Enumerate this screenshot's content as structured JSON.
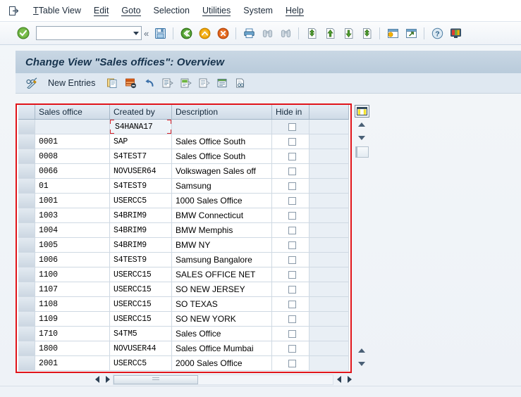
{
  "menubar": {
    "system_icon": "exit-arrow-icon",
    "items": [
      {
        "label": "Table View",
        "accel": "T"
      },
      {
        "label": "Edit",
        "accel": "E"
      },
      {
        "label": "Goto",
        "accel": "G"
      },
      {
        "label": "Selection",
        "accel": "l"
      },
      {
        "label": "Utilities",
        "accel": "i"
      },
      {
        "label": "System",
        "accel": "y"
      },
      {
        "label": "Help",
        "accel": "H"
      }
    ]
  },
  "toolbar": {
    "enter_label": "enter-check-icon",
    "command_field": {
      "value": "",
      "placeholder": ""
    },
    "more_label": "«",
    "buttons": [
      {
        "name": "save-button",
        "icon": "save-disk-icon"
      },
      {
        "name": "back-button",
        "icon": "back-green-arrow-icon"
      },
      {
        "name": "exit-button",
        "icon": "exit-yellow-arrow-icon"
      },
      {
        "name": "cancel-button",
        "icon": "cancel-red-x-icon"
      },
      {
        "name": "print-button",
        "icon": "printer-icon"
      },
      {
        "name": "find-button",
        "icon": "binoculars-icon"
      },
      {
        "name": "find-next-button",
        "icon": "binoculars-plus-icon"
      },
      {
        "name": "first-page-button",
        "icon": "first-page-icon"
      },
      {
        "name": "previous-page-button",
        "icon": "previous-page-icon"
      },
      {
        "name": "next-page-button",
        "icon": "next-page-icon"
      },
      {
        "name": "last-page-button",
        "icon": "last-page-icon"
      },
      {
        "name": "create-session-button",
        "icon": "new-session-icon"
      },
      {
        "name": "create-shortcut-button",
        "icon": "shortcut-arrow-icon"
      },
      {
        "name": "help-button",
        "icon": "question-mark-icon"
      },
      {
        "name": "customize-local-layout-button",
        "icon": "layout-monitor-icon"
      }
    ]
  },
  "panel": {
    "title": "Change View \"Sales offices\": Overview",
    "subtoolbar": {
      "display_change_icon": "glasses-pencil-icon",
      "new_entries_label": "New Entries",
      "buttons": [
        {
          "name": "copy-as-button",
          "icon": "copy-document-icon"
        },
        {
          "name": "delete-button",
          "icon": "delete-row-icon"
        },
        {
          "name": "undo-button",
          "icon": "undo-arrow-icon"
        },
        {
          "name": "previous-entry-button",
          "icon": "page-up-entry-icon"
        },
        {
          "name": "next-entry-button",
          "icon": "page-down-entry-icon"
        },
        {
          "name": "select-entry-button",
          "icon": "page-entry-icon"
        },
        {
          "name": "details-button",
          "icon": "details-list-icon"
        },
        {
          "name": "variant-button",
          "icon": "magnify-document-icon"
        }
      ]
    }
  },
  "grid": {
    "columns": [
      {
        "key": "select",
        "label": ""
      },
      {
        "key": "sales_office",
        "label": "Sales office"
      },
      {
        "key": "created_by",
        "label": "Created by"
      },
      {
        "key": "description",
        "label": "Description"
      },
      {
        "key": "hide_in",
        "label": "Hide in"
      }
    ],
    "focused_cell": {
      "row": 0,
      "column": "created_by",
      "value": "S4HANA17"
    },
    "rows": [
      {
        "sales_office": "",
        "created_by": "S4HANA17",
        "description": "",
        "hide_in": false,
        "focused": true
      },
      {
        "sales_office": "0001",
        "created_by": "SAP",
        "description": "Sales Office South",
        "hide_in": false
      },
      {
        "sales_office": "0008",
        "created_by": "S4TEST7",
        "description": "Sales Office South",
        "hide_in": false
      },
      {
        "sales_office": "0066",
        "created_by": "NOVUSER64",
        "description": "Volkswagen Sales off",
        "hide_in": false
      },
      {
        "sales_office": "01",
        "created_by": "S4TEST9",
        "description": "Samsung",
        "hide_in": false
      },
      {
        "sales_office": "1001",
        "created_by": "USERCC5",
        "description": "1000 Sales Office",
        "hide_in": false
      },
      {
        "sales_office": "1003",
        "created_by": "S4BRIM9",
        "description": "BMW Connecticut",
        "hide_in": false
      },
      {
        "sales_office": "1004",
        "created_by": "S4BRIM9",
        "description": "BMW Memphis",
        "hide_in": false
      },
      {
        "sales_office": "1005",
        "created_by": "S4BRIM9",
        "description": "BMW NY",
        "hide_in": false
      },
      {
        "sales_office": "1006",
        "created_by": "S4TEST9",
        "description": "Samsung Bangalore",
        "hide_in": false
      },
      {
        "sales_office": "1100",
        "created_by": "USERCC15",
        "description": "SALES OFFICE NET",
        "hide_in": false
      },
      {
        "sales_office": "1107",
        "created_by": "USERCC15",
        "description": "SO NEW JERSEY",
        "hide_in": false
      },
      {
        "sales_office": "1108",
        "created_by": "USERCC15",
        "description": "SO TEXAS",
        "hide_in": false
      },
      {
        "sales_office": "1109",
        "created_by": "USERCC15",
        "description": "SO NEW YORK",
        "hide_in": false
      },
      {
        "sales_office": "1710",
        "created_by": "S4TM5",
        "description": "Sales Office",
        "hide_in": false
      },
      {
        "sales_office": "1800",
        "created_by": "NOVUSER44",
        "description": "Sales Office Mumbai",
        "hide_in": false
      },
      {
        "sales_office": "2001",
        "created_by": "USERCC5",
        "description": "2000 Sales Office",
        "hide_in": false
      }
    ]
  },
  "controls": {
    "config_icon": "column-configuration-icon",
    "scroll_up_icon": "scroll-up-icon",
    "scroll_down_icon": "scroll-down-icon",
    "position_box_icon": "position-box-icon",
    "bottom_scroll_up_icon": "scroll-up-icon",
    "bottom_scroll_down_icon": "scroll-down-icon",
    "hscroll_left_icon": "scroll-left-icon",
    "hscroll_right_icon": "scroll-right-icon",
    "hscroll_left_icon_2": "scroll-left-icon",
    "hscroll_right_icon_2": "scroll-right-icon"
  },
  "colors": {
    "focus_red": "#e0141a",
    "title_bg": "#c3d3e1",
    "accent_blue": "#16334d"
  }
}
